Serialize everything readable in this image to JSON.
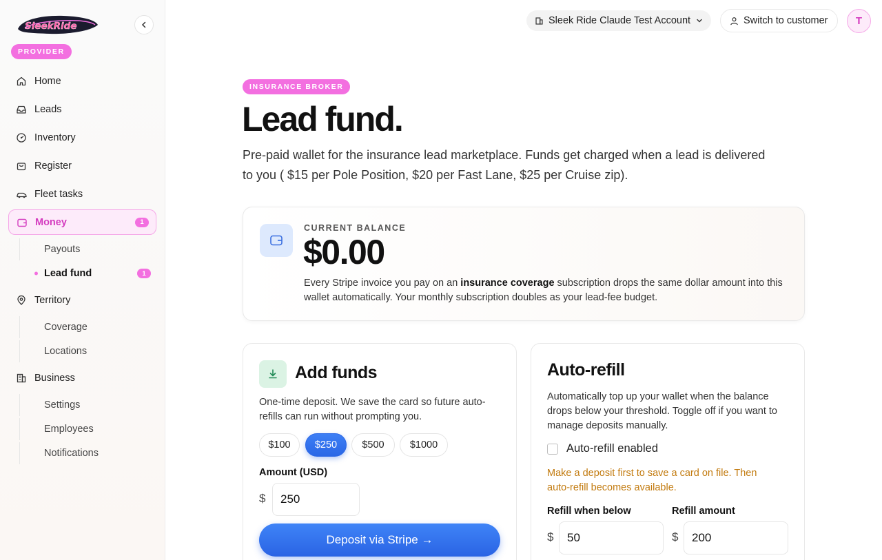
{
  "brand": {
    "logo_text": "SleekRide",
    "role_badge": "PROVIDER"
  },
  "sidebar": {
    "items": [
      {
        "label": "Home",
        "icon": "home-icon"
      },
      {
        "label": "Leads",
        "icon": "inbox-icon"
      },
      {
        "label": "Inventory",
        "icon": "gauge-icon"
      },
      {
        "label": "Register",
        "icon": "bag-icon"
      },
      {
        "label": "Fleet tasks",
        "icon": "car-icon"
      },
      {
        "label": "Money",
        "icon": "wallet-icon",
        "count": "1",
        "active": true
      },
      {
        "label": "Territory",
        "icon": "pin-icon"
      },
      {
        "label": "Business",
        "icon": "building-icon"
      }
    ],
    "money_sub": [
      {
        "label": "Payouts"
      },
      {
        "label": "Lead fund",
        "count": "1",
        "current": true
      }
    ],
    "territory_sub": [
      {
        "label": "Coverage"
      },
      {
        "label": "Locations"
      }
    ],
    "business_sub": [
      {
        "label": "Settings"
      },
      {
        "label": "Employees"
      },
      {
        "label": "Notifications"
      }
    ]
  },
  "topbar": {
    "account_name": "Sleek Ride Claude Test Account",
    "switch_label": "Switch to customer",
    "avatar_initial": "T"
  },
  "main": {
    "badge": "INSURANCE BROKER",
    "title": "Lead fund.",
    "description": "Pre-paid wallet for the insurance lead marketplace. Funds get charged when a lead is delivered to you ( $15 per Pole Position, $20 per Fast Lane, $25 per Cruise zip).",
    "balance": {
      "label": "CURRENT BALANCE",
      "amount": "$0.00",
      "note_prefix": "Every Stripe invoice you pay on an ",
      "note_bold": "insurance coverage",
      "note_suffix": " subscription drops the same dollar amount into this wallet automatically. Your monthly subscription doubles as your lead-fee budget."
    },
    "add_funds": {
      "title": "Add funds",
      "description": "One-time deposit. We save the card so future auto-refills can run without prompting you.",
      "presets": [
        "$100",
        "$250",
        "$500",
        "$1000"
      ],
      "selected_preset": "$250",
      "amount_label": "Amount (USD)",
      "currency_symbol": "$",
      "amount_value": "250",
      "deposit_label": "Deposit via Stripe →"
    },
    "auto_refill": {
      "title": "Auto-refill",
      "description": "Automatically top up your wallet when the balance drops below your threshold. Toggle off if you want to manage deposits manually.",
      "checkbox_label": "Auto-refill enabled",
      "checked": false,
      "warning": "Make a deposit first to save a card on file. Then auto-refill becomes available.",
      "threshold_label": "Refill when below",
      "threshold_value": "50",
      "amount_label": "Refill amount",
      "amount_value": "200",
      "currency_symbol": "$"
    }
  },
  "colors": {
    "accent_pink": "#f36fe0",
    "primary_blue": "#2a67e6",
    "warning": "#c27a0e"
  }
}
